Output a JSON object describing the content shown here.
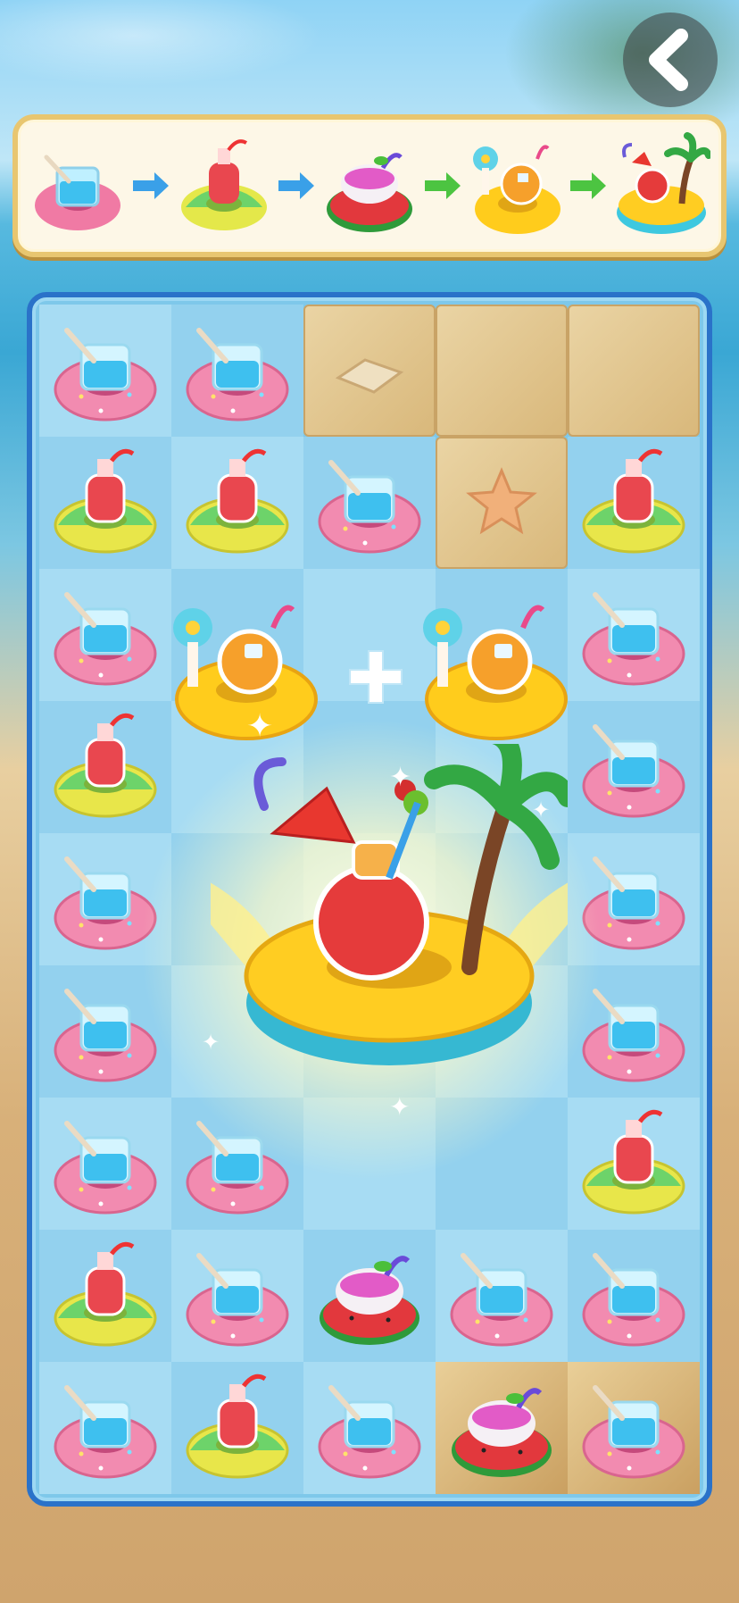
{
  "screen": "merge-game-board",
  "header": {
    "back_button_icon": "chevron-left-icon"
  },
  "recipe_chain": {
    "steps": [
      {
        "name": "blue-drink-on-pink-donut-float"
      },
      {
        "name": "red-bottle-on-green-yellow-float"
      },
      {
        "name": "pink-bowl-on-watermelon-float"
      },
      {
        "name": "orange-drink-with-flower-on-yellow-float"
      },
      {
        "name": "tropical-drink-with-palm-on-yellow-blue-float"
      }
    ],
    "arrow_colors": [
      "#3aa0e8",
      "#3aa0e8",
      "#4cc441",
      "#4cc441"
    ]
  },
  "board": {
    "columns": 5,
    "rows": 9,
    "cells": [
      [
        "blue-cup",
        "blue-cup",
        "sand",
        "sand",
        "sand"
      ],
      [
        "red-bottle",
        "red-bottle",
        "blue-cup",
        "sand",
        "red-bottle"
      ],
      [
        "blue-cup",
        "",
        "",
        "",
        "blue-cup"
      ],
      [
        "red-bottle",
        "",
        "",
        "",
        "blue-cup"
      ],
      [
        "blue-cup",
        "",
        "",
        "",
        "blue-cup"
      ],
      [
        "blue-cup",
        "",
        "",
        "",
        "blue-cup"
      ],
      [
        "blue-cup",
        "blue-cup",
        "",
        "",
        "red-bottle"
      ],
      [
        "red-bottle",
        "blue-cup",
        "watermelon-bowl",
        "blue-cup",
        "blue-cup"
      ],
      [
        "blue-cup",
        "red-bottle",
        "blue-cup",
        "watermelon-bowl",
        "blue-cup"
      ]
    ],
    "merge_animation": {
      "inputs": [
        "orange-drink-with-flower-on-yellow-float",
        "orange-drink-with-flower-on-yellow-float"
      ],
      "operator": "+",
      "result": "tropical-drink-with-palm-on-yellow-blue-float"
    }
  }
}
